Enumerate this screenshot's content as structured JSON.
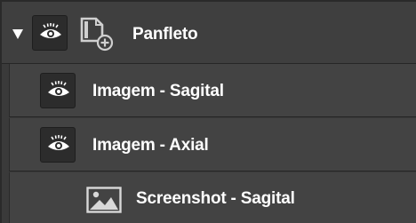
{
  "layers": {
    "group": {
      "label": "Panfleto",
      "expanded": true,
      "icon": "file-add-icon",
      "visibility_icon": "eye-icon"
    },
    "children": [
      {
        "label": "Imagem - Sagital",
        "visibility_icon": "eye-icon"
      },
      {
        "label": "Imagem - Axial",
        "visibility_icon": "eye-icon"
      },
      {
        "label": "Screenshot - Sagital",
        "icon": "image-icon"
      }
    ]
  },
  "colors": {
    "panel_bg": "#3a3a3a",
    "row_bg": "#434343",
    "button_bg": "#2c2c2c",
    "text": "#ffffff"
  }
}
